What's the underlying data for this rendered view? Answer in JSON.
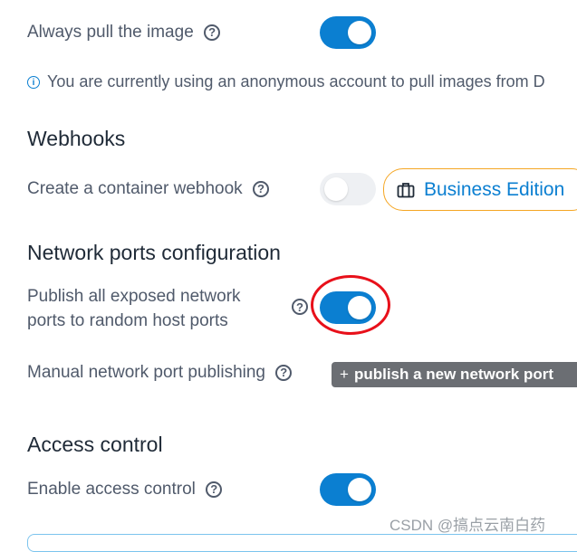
{
  "always_pull": {
    "label": "Always pull the image",
    "help": "?",
    "toggle_on": true
  },
  "info": {
    "icon": "info-icon",
    "text": "You are currently using an anonymous account to pull images from D"
  },
  "webhooks": {
    "title": "Webhooks",
    "create_label": "Create a container webhook",
    "help": "?",
    "toggle_on": false,
    "badge_icon": "briefcase-icon",
    "badge_label": "Business Edition"
  },
  "network": {
    "title": "Network ports configuration",
    "publish_all_line1": "Publish all exposed network",
    "publish_all_line2": "ports to random host ports",
    "help": "?",
    "publish_all_on": true,
    "manual_label": "Manual network port publishing",
    "manual_help": "?",
    "add_button_plus": "+",
    "add_button_label": "publish a new network port"
  },
  "access": {
    "title": "Access control",
    "enable_label": "Enable access control",
    "help": "?",
    "toggle_on": true
  },
  "watermark": "CSDN @搞点云南白药",
  "colors": {
    "accent": "#0b7fd1",
    "badge_border": "#f5a623",
    "highlight": "#e8101a",
    "button_bg": "#6b6e73"
  }
}
